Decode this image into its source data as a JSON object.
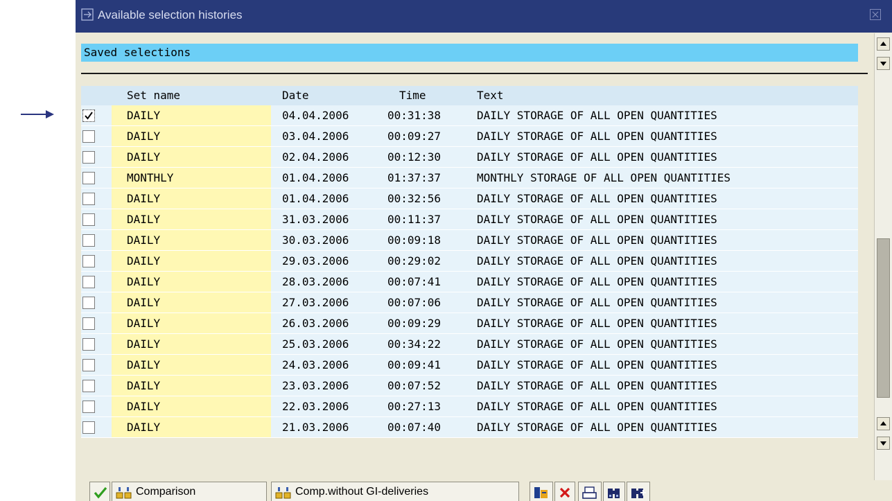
{
  "dialog": {
    "title": "Available selection histories",
    "section_header": "Saved selections"
  },
  "columns": [
    "Set name",
    "Date",
    "Time",
    "Text"
  ],
  "rows": [
    {
      "checked": true,
      "set": "DAILY",
      "date": "04.04.2006",
      "time": "00:31:38",
      "text": "DAILY STORAGE OF ALL OPEN QUANTITIES"
    },
    {
      "checked": false,
      "set": "DAILY",
      "date": "03.04.2006",
      "time": "00:09:27",
      "text": "DAILY STORAGE OF ALL OPEN QUANTITIES"
    },
    {
      "checked": false,
      "set": "DAILY",
      "date": "02.04.2006",
      "time": "00:12:30",
      "text": "DAILY STORAGE OF ALL OPEN QUANTITIES"
    },
    {
      "checked": false,
      "set": "MONTHLY",
      "date": "01.04.2006",
      "time": "01:37:37",
      "text": "MONTHLY STORAGE OF ALL OPEN QUANTITIES"
    },
    {
      "checked": false,
      "set": "DAILY",
      "date": "01.04.2006",
      "time": "00:32:56",
      "text": "DAILY STORAGE OF ALL OPEN QUANTITIES"
    },
    {
      "checked": false,
      "set": "DAILY",
      "date": "31.03.2006",
      "time": "00:11:37",
      "text": "DAILY STORAGE OF ALL OPEN QUANTITIES"
    },
    {
      "checked": false,
      "set": "DAILY",
      "date": "30.03.2006",
      "time": "00:09:18",
      "text": "DAILY STORAGE OF ALL OPEN QUANTITIES"
    },
    {
      "checked": false,
      "set": "DAILY",
      "date": "29.03.2006",
      "time": "00:29:02",
      "text": "DAILY STORAGE OF ALL OPEN QUANTITIES"
    },
    {
      "checked": false,
      "set": "DAILY",
      "date": "28.03.2006",
      "time": "00:07:41",
      "text": "DAILY STORAGE OF ALL OPEN QUANTITIES"
    },
    {
      "checked": false,
      "set": "DAILY",
      "date": "27.03.2006",
      "time": "00:07:06",
      "text": "DAILY STORAGE OF ALL OPEN QUANTITIES"
    },
    {
      "checked": false,
      "set": "DAILY",
      "date": "26.03.2006",
      "time": "00:09:29",
      "text": "DAILY STORAGE OF ALL OPEN QUANTITIES"
    },
    {
      "checked": false,
      "set": "DAILY",
      "date": "25.03.2006",
      "time": "00:34:22",
      "text": "DAILY STORAGE OF ALL OPEN QUANTITIES"
    },
    {
      "checked": false,
      "set": "DAILY",
      "date": "24.03.2006",
      "time": "00:09:41",
      "text": "DAILY STORAGE OF ALL OPEN QUANTITIES"
    },
    {
      "checked": false,
      "set": "DAILY",
      "date": "23.03.2006",
      "time": "00:07:52",
      "text": "DAILY STORAGE OF ALL OPEN QUANTITIES"
    },
    {
      "checked": false,
      "set": "DAILY",
      "date": "22.03.2006",
      "time": "00:27:13",
      "text": "DAILY STORAGE OF ALL OPEN QUANTITIES"
    },
    {
      "checked": false,
      "set": "DAILY",
      "date": "21.03.2006",
      "time": "00:07:40",
      "text": "DAILY STORAGE OF ALL OPEN QUANTITIES"
    }
  ],
  "toolbar": {
    "comparison_label": "Comparison",
    "comp_without_label": "Comp.without GI-deliveries",
    "icons": [
      "check-icon",
      "comparison-icon",
      "comp-without-icon",
      "layout-icon",
      "delete-icon",
      "print-icon",
      "find-icon",
      "find-next-icon"
    ]
  },
  "colors": {
    "title_bar": "#283a7a",
    "section_header": "#6ccff6",
    "grid_header": "#d6e8f4",
    "row_bg": "#e7f3fa",
    "set_name_bg": "#fff8b4",
    "dialog_bg": "#ece9d8"
  }
}
